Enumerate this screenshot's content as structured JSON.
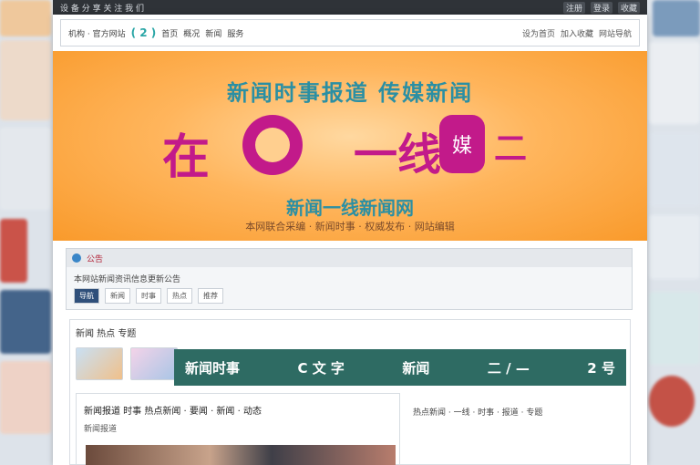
{
  "topbar": {
    "left_text": "设 备 分 享  关 注 我 们",
    "links": [
      "注册",
      "登录",
      "收藏"
    ]
  },
  "header": {
    "logo_mark": "( 2 )",
    "logo_text": "机构 · 官方网站",
    "nav": [
      "首页",
      "概况",
      "新闻",
      "服务"
    ],
    "util": [
      "设为首页",
      "加入收藏",
      "网站导航"
    ]
  },
  "banner": {
    "title": "新闻时事报道 传媒新闻",
    "big": "在",
    "right": "一线",
    "seal": "媒",
    "tail": "二",
    "subtitle": "新闻一线新闻网",
    "subtitle2": "本网联合采编 · 新闻时事 · 权威发布 · 网站编辑"
  },
  "notice": {
    "bar_label": "公告",
    "line": "本网站新闻资讯信息更新公告",
    "tags": [
      "导航",
      "新闻",
      "时事",
      "热点",
      "推荐"
    ]
  },
  "content": {
    "title": "新闻 热点 专题",
    "strip_text": [
      "新闻时事",
      "C 文 字",
      "新闻",
      "二 / —",
      "2 号"
    ],
    "article_title": "新闻报道 时事 热点新闻 · 要闻 · 新闻 · 动态",
    "article_meta": "新闻报道",
    "side_text": "热点新闻 · 一线 · 时事 · 报道 · 专题"
  },
  "colors": {
    "banner_orange": "#f99a2b",
    "accent_magenta": "#c21a8a",
    "accent_teal": "#2b8fa3",
    "strip_green": "#2e6b63"
  }
}
